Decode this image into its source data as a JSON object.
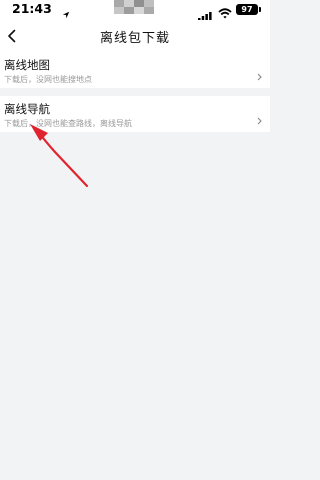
{
  "status_bar": {
    "time": "21:43",
    "battery": "97",
    "icons": [
      "location-arrow-icon",
      "signal-icon",
      "wifi-icon",
      "battery-icon"
    ]
  },
  "nav": {
    "title": "离线包下载",
    "back_icon": "chevron-left-icon"
  },
  "list": {
    "items": [
      {
        "title": "离线地图",
        "subtitle": "下载后，没网也能搜地点"
      },
      {
        "title": "离线导航",
        "subtitle": "下载后，没网也能查路线，离线导航"
      }
    ]
  },
  "colors": {
    "background": "#f2f3f5",
    "card": "#ffffff",
    "title_text": "#111111",
    "subtitle_text": "#999999",
    "annotation_arrow": "#e0242f"
  }
}
